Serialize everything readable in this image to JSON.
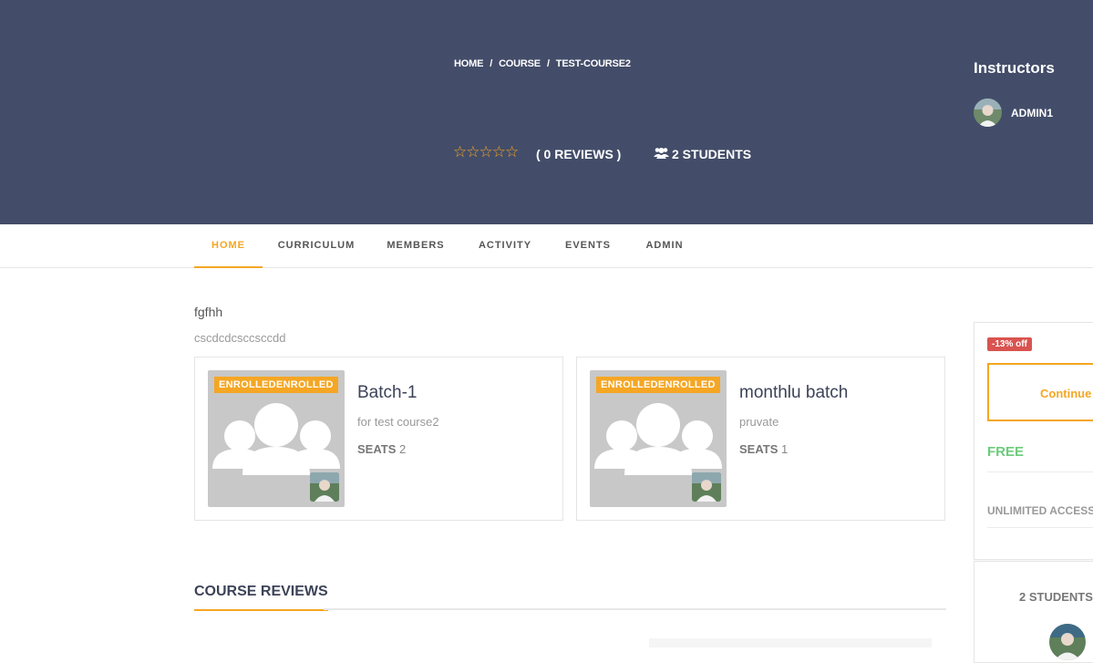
{
  "header": {
    "breadcrumb": [
      "HOME",
      "COURSE",
      "TEST-COURSE2"
    ],
    "rating": {
      "value": 0,
      "max": 5,
      "stars": "☆☆☆☆☆"
    },
    "reviews_label": "( 0 REVIEWS )",
    "students_label": "2 STUDENTS",
    "instructors_title": "Instructors",
    "instructor_name": "ADMIN1"
  },
  "tabs": [
    {
      "label": "HOME",
      "active": true
    },
    {
      "label": "CURRICULUM",
      "active": false
    },
    {
      "label": "MEMBERS",
      "active": false
    },
    {
      "label": "ACTIVITY",
      "active": false
    },
    {
      "label": "EVENTS",
      "active": false
    },
    {
      "label": "ADMIN",
      "active": false
    }
  ],
  "course": {
    "description_title": "fgfhh",
    "description_text": "cscdcdcsccsccdd"
  },
  "batches": [
    {
      "badge": "ENROLLEDENROLLED",
      "name": "Batch-1",
      "description": "for test course2",
      "seats_label": "SEATS",
      "seats": "2"
    },
    {
      "badge": "ENROLLEDENROLLED",
      "name": "monthlu batch",
      "description": "pruvate",
      "seats_label": "SEATS",
      "seats": "1"
    }
  ],
  "reviews": {
    "heading": "COURSE REVIEWS"
  },
  "sidebar": {
    "discount": "-13%  off",
    "continue_label": "Continue",
    "price": "FREE",
    "access": "UNLIMITED ACCESS",
    "students_label": "2 STUDENTS"
  },
  "colors": {
    "hero_bg": "#434d69",
    "accent": "#f5a623",
    "discount": "#d9534f",
    "free": "#6ccc7c"
  }
}
